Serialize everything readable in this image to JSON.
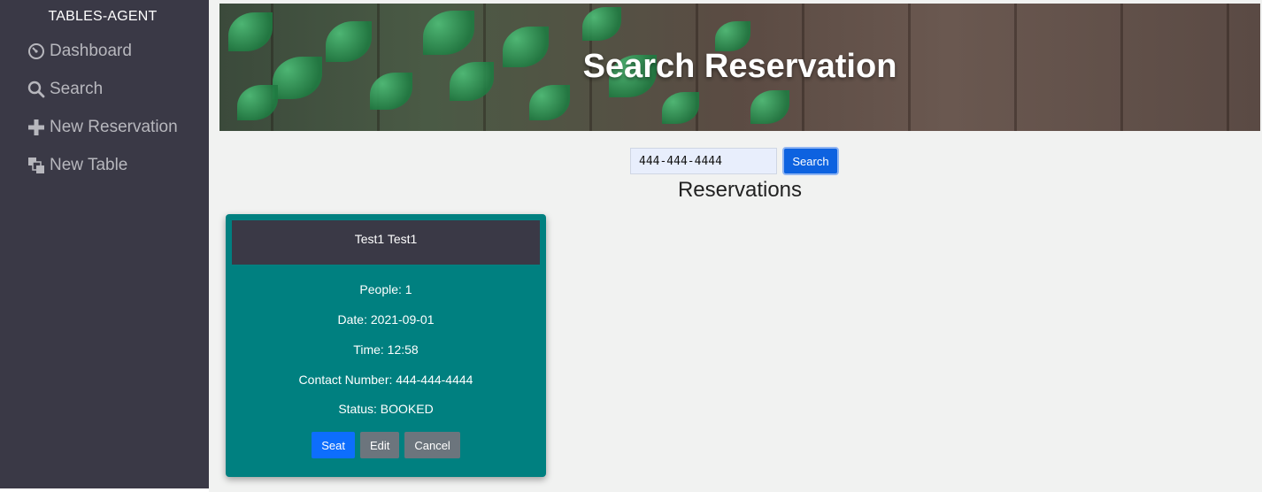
{
  "sidebar": {
    "brand": "TABLES-AGENT",
    "items": [
      {
        "label": "Dashboard",
        "icon": "dashboard-icon"
      },
      {
        "label": "Search",
        "icon": "search-icon"
      },
      {
        "label": "New Reservation",
        "icon": "plus-icon"
      },
      {
        "label": "New Table",
        "icon": "new-table-icon"
      }
    ]
  },
  "header": {
    "title": "Search Reservation"
  },
  "search": {
    "value": "444-444-4444",
    "button_label": "Search"
  },
  "section_title": "Reservations",
  "reservations": [
    {
      "name": "Test1 Test1",
      "people": "People: 1",
      "date": "Date: 2021-09-01",
      "time": "Time: 12:58",
      "contact": "Contact Number: 444-444-4444",
      "status": "Status: BOOKED",
      "actions": {
        "seat": "Seat",
        "edit": "Edit",
        "cancel": "Cancel"
      }
    }
  ],
  "colors": {
    "sidebar_bg": "#3a3946",
    "card_bg": "#008080",
    "primary_button": "#0d6efd",
    "secondary_button": "#6c757d"
  }
}
